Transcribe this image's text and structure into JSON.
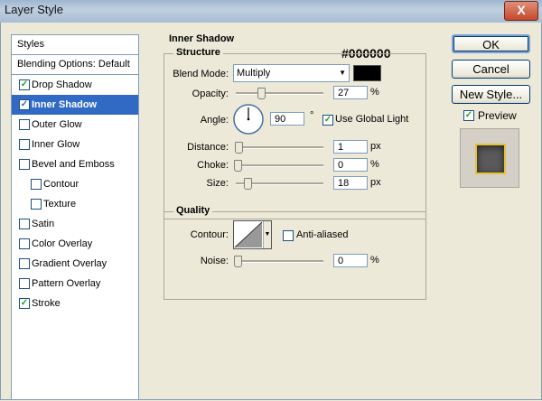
{
  "window": {
    "title": "Layer Style",
    "close": "X"
  },
  "styles_panel": {
    "header": "Styles",
    "blending": "Blending Options: Default",
    "items": [
      {
        "label": "Drop Shadow",
        "checked": true
      },
      {
        "label": "Inner Shadow",
        "checked": true,
        "selected": true
      },
      {
        "label": "Outer Glow",
        "checked": false
      },
      {
        "label": "Inner Glow",
        "checked": false
      },
      {
        "label": "Bevel and Emboss",
        "checked": false
      },
      {
        "label": "Contour",
        "checked": false,
        "indent": true
      },
      {
        "label": "Texture",
        "checked": false,
        "indent": true
      },
      {
        "label": "Satin",
        "checked": false
      },
      {
        "label": "Color Overlay",
        "checked": false
      },
      {
        "label": "Gradient Overlay",
        "checked": false
      },
      {
        "label": "Pattern Overlay",
        "checked": false
      },
      {
        "label": "Stroke",
        "checked": true
      }
    ]
  },
  "inner_shadow": {
    "title": "Inner Shadow",
    "color_hex": "#000000",
    "structure": {
      "title": "Structure",
      "blend_mode_label": "Blend Mode:",
      "blend_mode_value": "Multiply",
      "opacity_label": "Opacity:",
      "opacity_value": "27",
      "opacity_unit": "%",
      "angle_label": "Angle:",
      "angle_value": "90",
      "angle_unit": "°",
      "use_global_light": "Use Global Light",
      "distance_label": "Distance:",
      "distance_value": "1",
      "distance_unit": "px",
      "choke_label": "Choke:",
      "choke_value": "0",
      "choke_unit": "%",
      "size_label": "Size:",
      "size_value": "18",
      "size_unit": "px"
    },
    "quality": {
      "title": "Quality",
      "contour_label": "Contour:",
      "anti_aliased": "Anti-aliased",
      "noise_label": "Noise:",
      "noise_value": "0",
      "noise_unit": "%"
    }
  },
  "buttons": {
    "ok": "OK",
    "cancel": "Cancel",
    "new_style": "New Style...",
    "preview": "Preview"
  },
  "colors": {
    "selection": "#316ac5",
    "shadow": "#000000"
  }
}
